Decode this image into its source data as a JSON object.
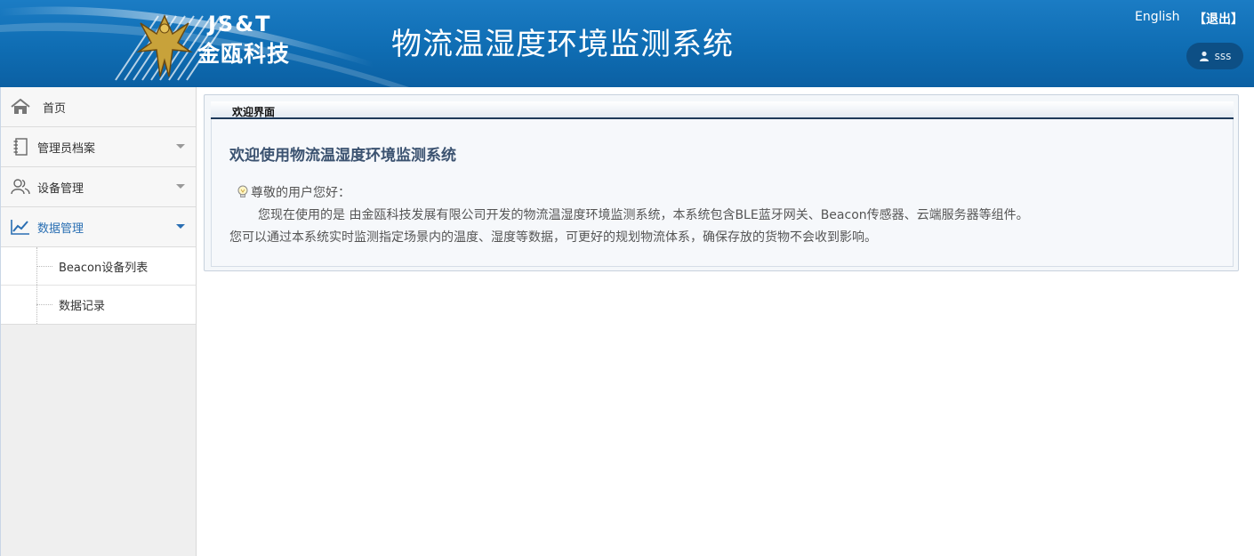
{
  "header": {
    "logo_top": "JS&T",
    "logo_bottom": "金瓯科技",
    "system_title": "物流温湿度环境监测系统",
    "english_label": "English",
    "logout_label": "【退出】",
    "username": "sss",
    "user_icon": "user-icon"
  },
  "sidebar": {
    "items": [
      {
        "label": "首页",
        "icon": "home-icon"
      },
      {
        "label": "管理员档案",
        "icon": "notebook-icon"
      },
      {
        "label": "设备管理",
        "icon": "users-icon"
      },
      {
        "label": "数据管理",
        "icon": "line-chart-icon"
      }
    ],
    "subitems": [
      {
        "label": "Beacon设备列表"
      },
      {
        "label": "数据记录"
      }
    ]
  },
  "main": {
    "tab_label": "欢迎界面",
    "welcome_title": "欢迎使用物流温湿度环境监测系统",
    "greeting": "尊敬的用户您好：",
    "paragraph1": "您现在使用的是 由金瓯科技发展有限公司开发的物流温湿度环境监测系统，本系统包含BLE蓝牙网关、Beacon传感器、云端服务器等组件。",
    "paragraph2": "您可以通过本系统实时监测指定场景内的温度、湿度等数据，可更好的规划物流体系，确保存放的货物不会收到影响。"
  },
  "colors": {
    "header_blue": "#0f6db3",
    "active_menu": "#2a6fb3",
    "title_text": "#3b5270"
  }
}
